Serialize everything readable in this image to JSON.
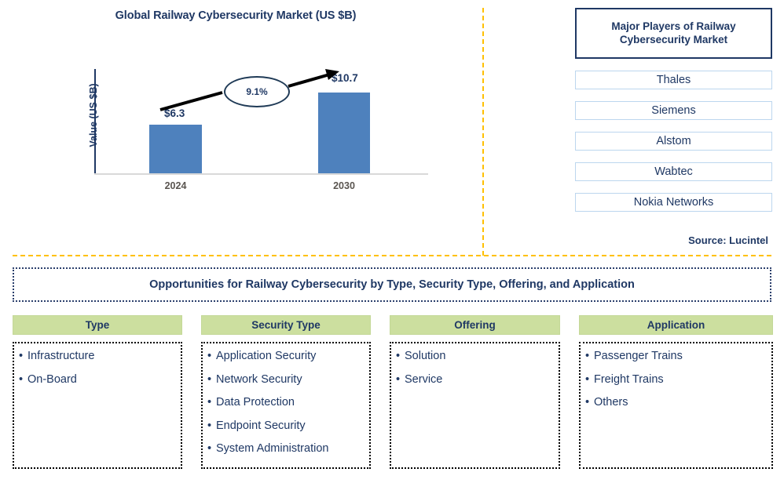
{
  "chart": {
    "title": "Global Railway Cybersecurity Market (US $B)",
    "y_axis_label": "Value (US $B)",
    "cagr_label": "9.1%",
    "source": "Source: Lucintel"
  },
  "chart_data": {
    "type": "bar",
    "title": "Global Railway Cybersecurity Market (US $B)",
    "categories": [
      "2024",
      "2030"
    ],
    "values": [
      6.3,
      10.7
    ],
    "data_labels": [
      "$6.3",
      "$10.7"
    ],
    "xlabel": "",
    "ylabel": "Value (US $B)",
    "ylim": [
      0,
      12
    ],
    "grid": false,
    "legend": "none",
    "annotations": [
      {
        "text": "9.1%",
        "type": "cagr-callout",
        "from": "2024",
        "to": "2030"
      }
    ],
    "series_color": "#4e81bd",
    "source": "Source: Lucintel"
  },
  "players": {
    "title": "Major Players of Railway Cybersecurity Market",
    "items": [
      "Thales",
      "Siemens",
      "Alstom",
      "Wabtec",
      "Nokia Networks"
    ]
  },
  "opportunities": {
    "banner": "Opportunities for Railway Cybersecurity by Type, Security Type, Offering, and Application",
    "columns": [
      {
        "header": "Type",
        "items": [
          "Infrastructure",
          "On-Board"
        ]
      },
      {
        "header": "Security Type",
        "items": [
          "Application Security",
          "Network Security",
          "Data Protection",
          "Endpoint Security",
          "System Administration"
        ]
      },
      {
        "header": "Offering",
        "items": [
          "Solution",
          "Service"
        ]
      },
      {
        "header": "Application",
        "items": [
          "Passenger Trains",
          "Freight Trains",
          "Others"
        ]
      }
    ]
  },
  "colors": {
    "bar": "#4e81bd",
    "navy": "#1f3864",
    "header_green": "#ccdf9f",
    "divider": "#ffc000"
  }
}
